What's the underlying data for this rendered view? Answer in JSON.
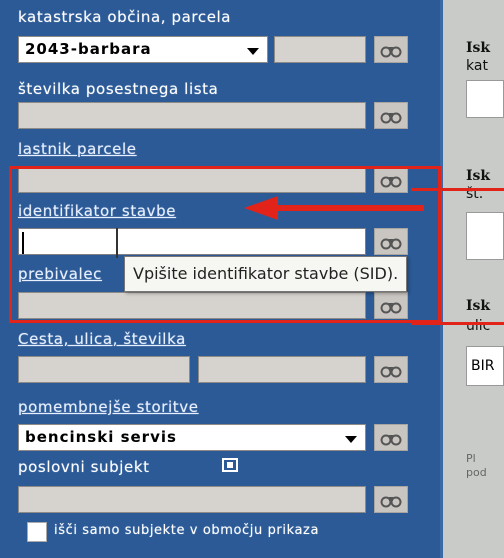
{
  "form": {
    "cadastral_label": "katastrska občina, parcela",
    "cadastral_select": "2043-barbara",
    "sheet_label": "številka posestnega lista",
    "owner_label": "lastnik parcele",
    "building_label": "identifikator stavbe",
    "resident_label": "prebivalec",
    "address_label": "Cesta, ulica, številka",
    "services_label": "pomembnejše storitve",
    "services_select": "bencinski servis",
    "business_label": "poslovni subjekt",
    "checkbox_label": "išči samo subjekte v območju prikaza"
  },
  "tooltip": {
    "text": "Vpišite identifikator stavbe (SID)."
  },
  "right_panel": {
    "title1": "Isk",
    "sub1": "kat",
    "title2": "Isk",
    "sub2": "št.",
    "title3": "Isk",
    "sub3": "ulic",
    "field3": "BIR",
    "note1": "Pl",
    "note2": "pod"
  },
  "colors": {
    "panel_bg": "#2c5a96",
    "highlight": "#e2231a"
  },
  "icons": [
    "binoculars-icon",
    "dropdown-arrow-icon",
    "info-icon"
  ]
}
